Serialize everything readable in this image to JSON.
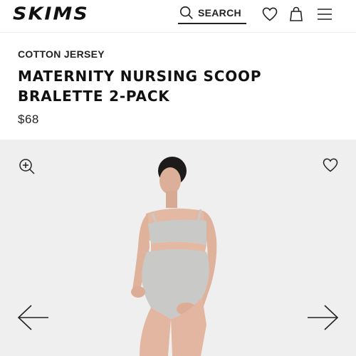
{
  "header": {
    "logo": "SKIMS",
    "search_label": "SEARCH"
  },
  "product": {
    "category": "COTTON JERSEY",
    "title": "MATERNITY NURSING SCOOP BRALETTE 2-PACK",
    "price": "$68"
  },
  "colors": {
    "text": "#111111",
    "gallery_background": "#efefef",
    "garment": "#c9cac8",
    "skin": "#e4b9a4"
  },
  "icons": [
    "search-icon",
    "heart-icon",
    "shopping-bag-icon",
    "menu-icon",
    "zoom-in-icon",
    "arrow-left-icon",
    "arrow-right-icon"
  ]
}
